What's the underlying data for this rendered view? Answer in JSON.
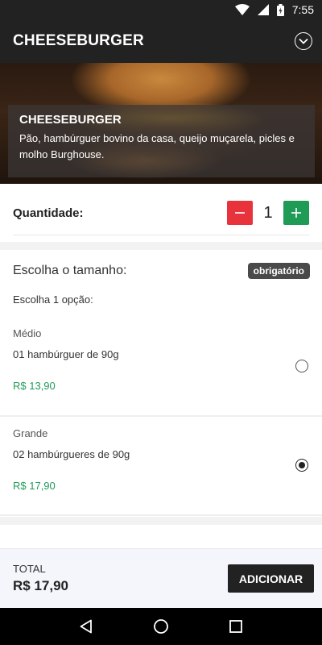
{
  "status_bar": {
    "time": "7:55",
    "icons": [
      "wifi-icon",
      "signal-icon",
      "battery-icon"
    ]
  },
  "app_bar": {
    "title": "CHEESEBURGER",
    "icon": "chevron-down-circle-icon"
  },
  "hero": {
    "title": "CHEESEBURGER",
    "description": "Pão, hambúrguer bovino da casa, queijo muçarela, picles e molho Burghouse."
  },
  "quantity": {
    "label": "Quantidade:",
    "value": "1",
    "minus_icon": "minus-icon",
    "plus_icon": "plus-icon"
  },
  "size_section": {
    "title": "Escolha o tamanho:",
    "badge": "obrigatório",
    "subtitle": "Escolha 1 opção:",
    "options": [
      {
        "name": "Médio",
        "description": "01 hambúrguer de 90g",
        "price": "R$ 13,90",
        "selected": false
      },
      {
        "name": "Grande",
        "description": "02 hambúrgueres de 90g",
        "price": "R$ 17,90",
        "selected": true
      }
    ]
  },
  "footer": {
    "total_label": "TOTAL",
    "total_value": "R$ 17,90",
    "add_button": "ADICIONAR"
  },
  "nav_bar": {
    "icons": [
      "back-icon",
      "home-icon",
      "recents-icon"
    ]
  },
  "colors": {
    "primary": "#222222",
    "accent_green": "#1f9b56",
    "accent_red": "#e8323c"
  }
}
